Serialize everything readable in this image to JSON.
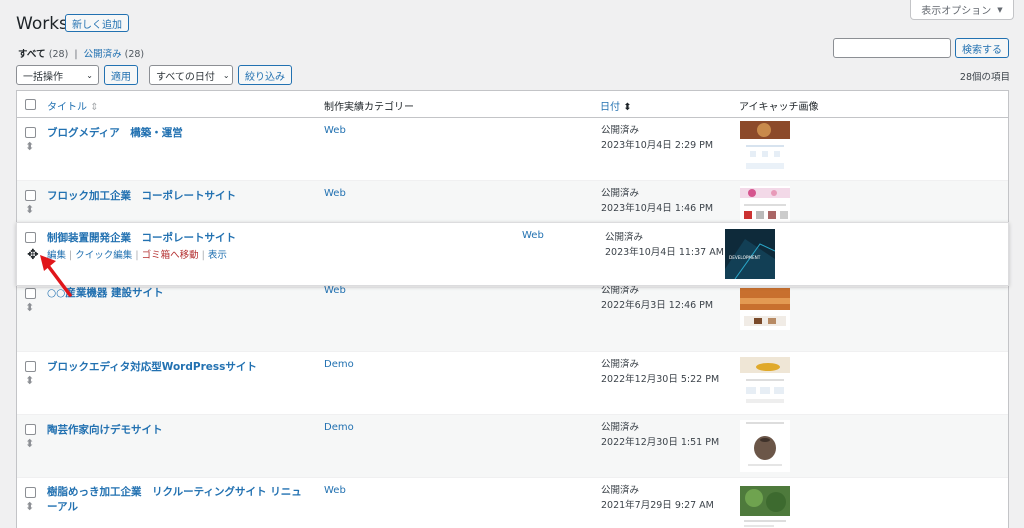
{
  "header": {
    "screen_options": "表示オプション",
    "title": "Works",
    "add_new": "新しく追加"
  },
  "filters": {
    "all_label": "すべて",
    "all_count": "(28)",
    "separator": "|",
    "published_label": "公開済み",
    "published_count": "(28)"
  },
  "search": {
    "button": "検索する",
    "placeholder": ""
  },
  "tablenav": {
    "bulk_action": "一括操作",
    "apply": "適用",
    "all_dates": "すべての日付",
    "filter": "絞り込み",
    "item_count": "28個の項目"
  },
  "columns": {
    "title": "タイトル",
    "category": "制作実績カテゴリー",
    "date": "日付",
    "thumbnail": "アイキャッチ画像"
  },
  "rows": [
    {
      "title": "ブログメディア　構築・運営",
      "category": "Web",
      "status": "公開済み",
      "date": "2023年10月4日 2:29 PM"
    },
    {
      "title": "フロック加工企業　コーポレートサイト",
      "category": "Web",
      "status": "公開済み",
      "date": "2023年10月4日 1:46 PM"
    },
    {
      "title": "制御装置開発企業　コーポレートサイト",
      "category": "Web",
      "status": "公開済み",
      "date": "2023年10月4日 11:37 AM"
    },
    {
      "title": "○○産業機器 建設サイト",
      "category": "Web",
      "status": "公開済み",
      "date": "2022年6月3日 12:46 PM"
    },
    {
      "title": "ブロックエディタ対応型WordPressサイト",
      "category": "Demo",
      "status": "公開済み",
      "date": "2022年12月30日 5:22 PM"
    },
    {
      "title": "陶芸作家向けデモサイト",
      "category": "Demo",
      "status": "公開済み",
      "date": "2022年12月30日 1:51 PM"
    },
    {
      "title": "樹脂めっき加工企業　リクルーティングサイト リニューアル",
      "category": "Web",
      "status": "公開済み",
      "date": "2021年7月29日 9:27 AM"
    }
  ],
  "row_actions": {
    "edit": "編集",
    "quick_edit": "クイック編集",
    "trash": "ゴミ箱へ移動",
    "view": "表示"
  },
  "thumbnail_overlay_text": "DEVELOPMENT",
  "colors": {
    "link": "#2271b1",
    "trash": "#b32d2e",
    "arrow": "#e0161a",
    "background": "#f0f0f1"
  }
}
